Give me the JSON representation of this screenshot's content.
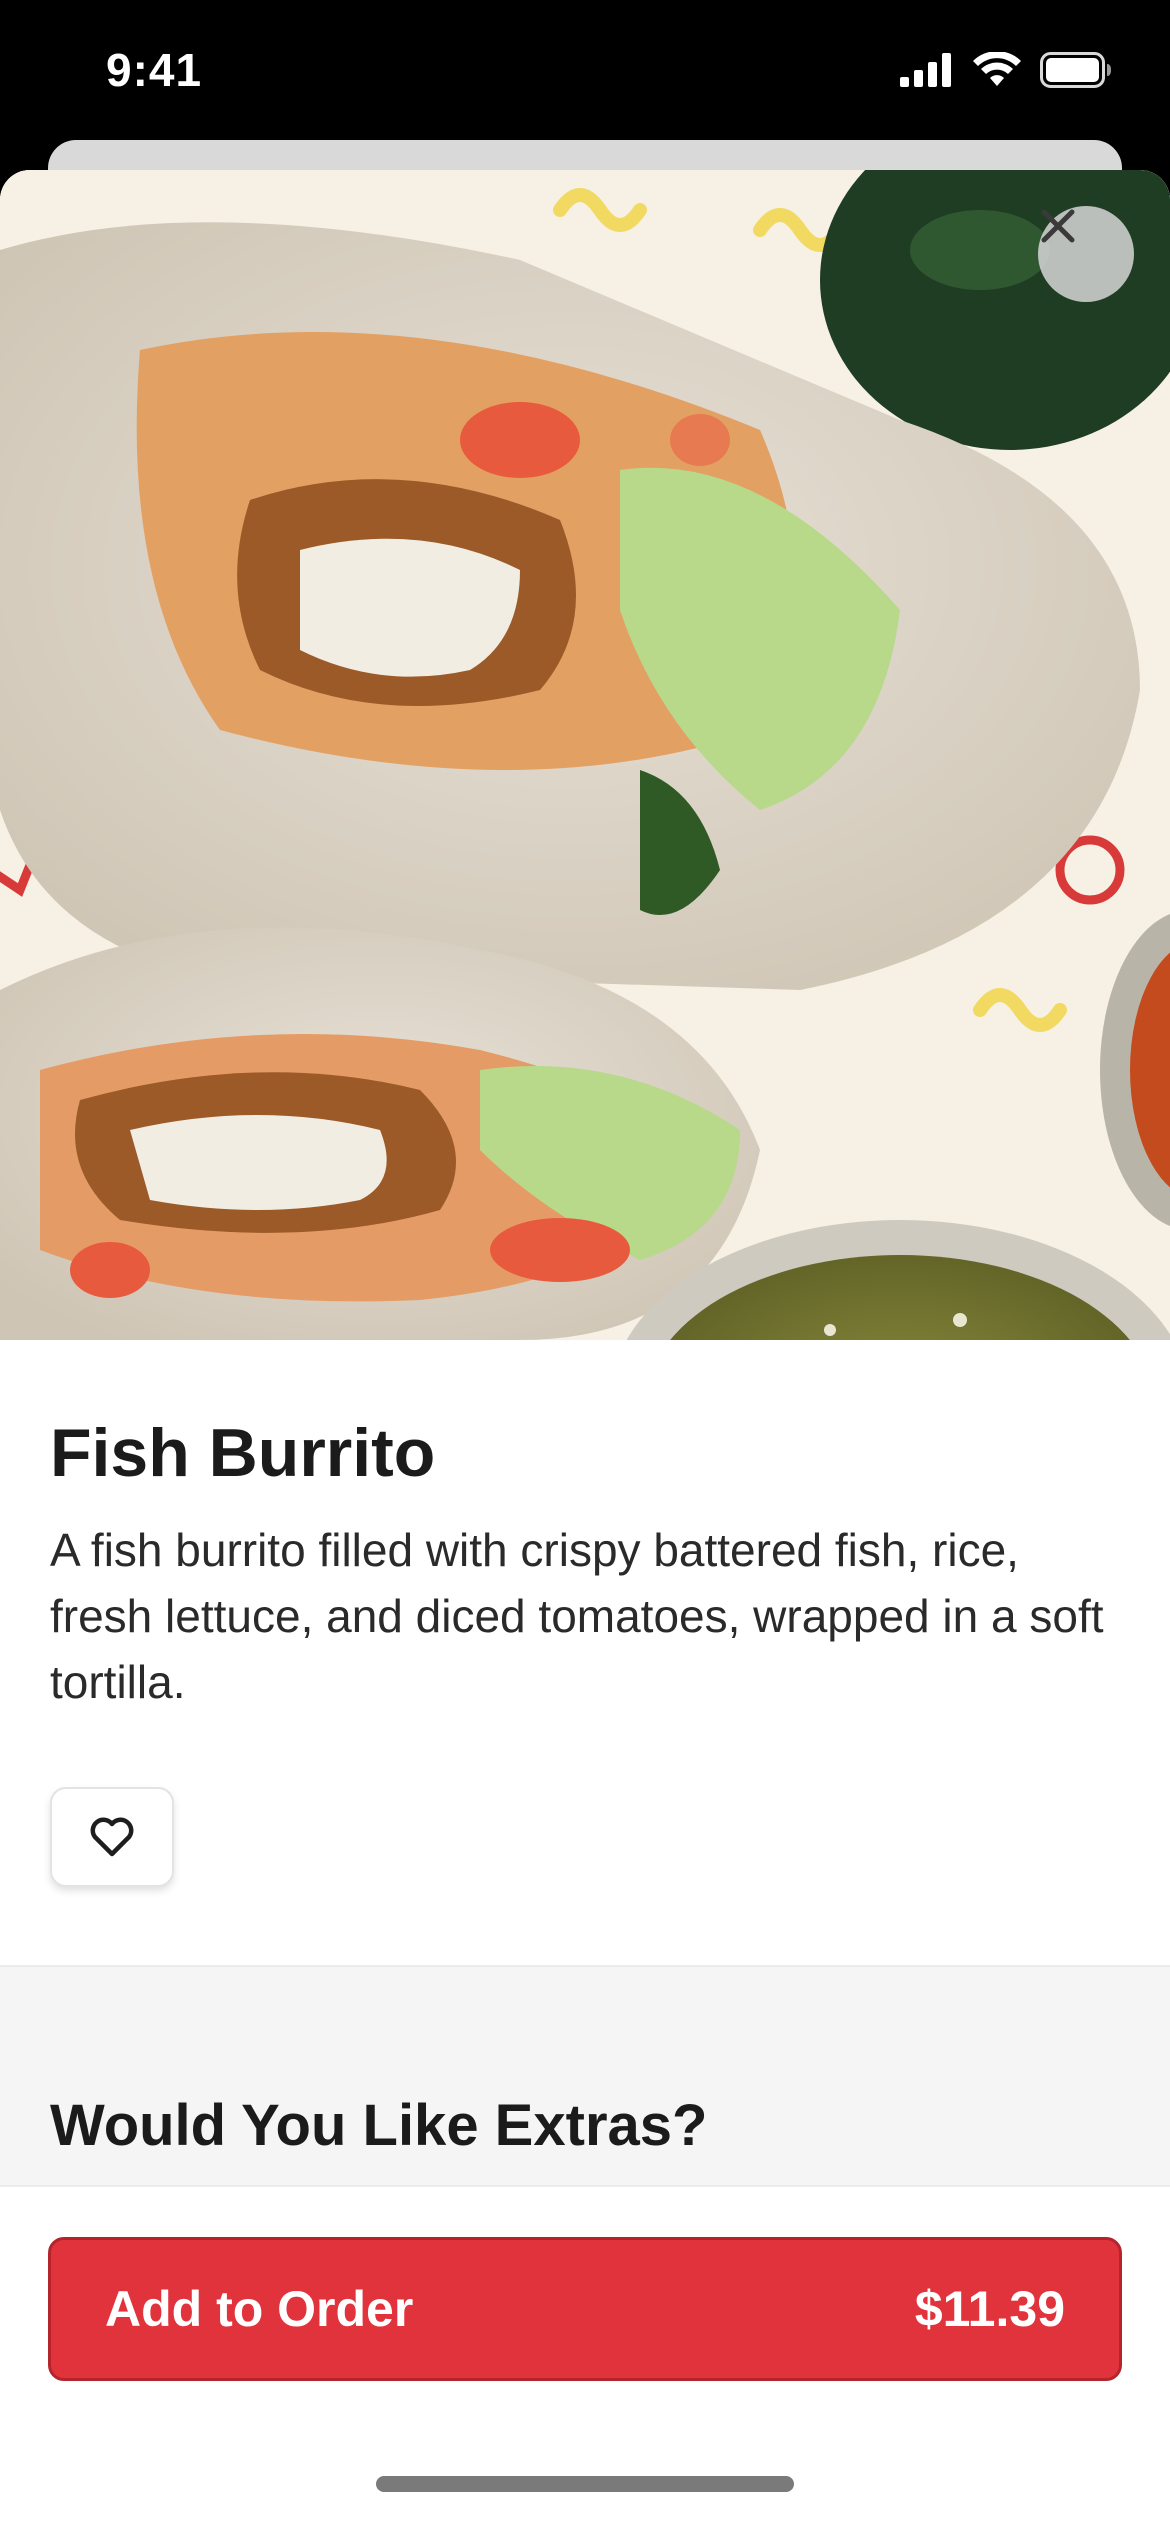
{
  "status_bar": {
    "time": "9:41",
    "icons": [
      "cellular-signal-icon",
      "wifi-icon",
      "battery-icon"
    ]
  },
  "hero": {
    "image": "fish-burrito-photo",
    "close_icon": "close-icon"
  },
  "product": {
    "title": "Fish Burrito",
    "description": "A fish burrito filled with crispy battered fish, rice, fresh lettuce, and diced tomatoes, wrapped in a soft tortilla.",
    "favorite_icon": "heart-outline-icon"
  },
  "extras": {
    "title": "Would You Like Extras?"
  },
  "order_button": {
    "label": "Add to Order",
    "price": "$11.39"
  },
  "colors": {
    "accent": "#e1333b",
    "accent_border": "#b4242b",
    "text_primary": "#1b1b1b",
    "section_bg": "#f5f5f5"
  }
}
